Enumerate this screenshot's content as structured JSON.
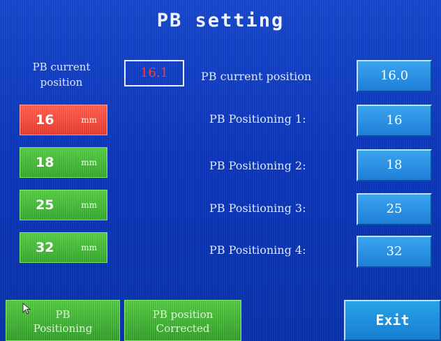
{
  "title": "PB setting",
  "current": {
    "label_line1": "PB current",
    "label_line2": "position",
    "value": "16.1",
    "row_label": "PB current position",
    "display_value": "16.0"
  },
  "positions": [
    {
      "button_value": "16",
      "unit": "mm",
      "label": "PB Positioning 1:",
      "value": "16",
      "active": true
    },
    {
      "button_value": "18",
      "unit": "mm",
      "label": "PB Positioning 2:",
      "value": "18",
      "active": false
    },
    {
      "button_value": "25",
      "unit": "mm",
      "label": "PB Positioning 3:",
      "value": "25",
      "active": false
    },
    {
      "button_value": "32",
      "unit": "mm",
      "label": "PB Positioning 4:",
      "value": "32",
      "active": false
    }
  ],
  "buttons": {
    "positioning_line1": "PB",
    "positioning_line2": "Positioning",
    "corrected_line1": "PB position",
    "corrected_line2": "Corrected",
    "exit": "Exit"
  },
  "colors": {
    "background": "#0b35b9",
    "active_button": "#e23628",
    "inactive_button": "#33a42a",
    "value_box": "#1e7fd8",
    "current_value_text": "#ff3b30"
  },
  "icons": {
    "cursor": "mouse-pointer-icon"
  }
}
